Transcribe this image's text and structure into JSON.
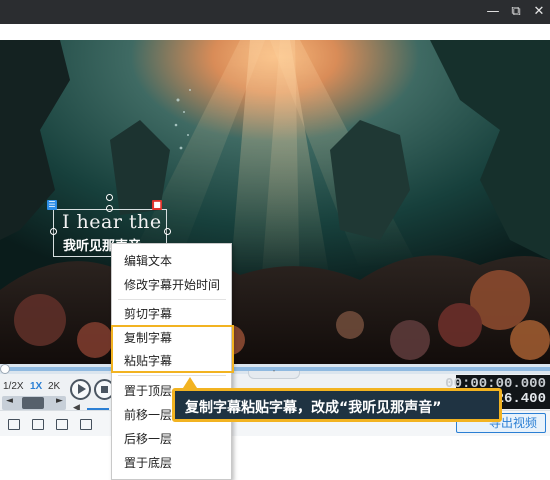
{
  "window": {
    "minimize_icon": "minimize-icon",
    "maximize_icon": "restore-icon",
    "close_icon": "close-icon",
    "minimize_glyph": "—",
    "maximize_glyph": "⧉",
    "close_glyph": "✕"
  },
  "video": {
    "subtitle_en": "I hear the",
    "subtitle_zh": "我听见那声音",
    "edit_glyph": "☰",
    "delete_glyph": "■"
  },
  "player": {
    "speeds": [
      "1/2X",
      "1X",
      "2K"
    ],
    "active_speed": "1X",
    "frame_back": "◄",
    "frame_forward": "►",
    "volume_glyph": "◀",
    "collapse_glyph": "˅",
    "progress": 0.0,
    "current_time": "00:00:00.000",
    "total_time": "26.400"
  },
  "toolbar": {
    "export_label": "导出视频"
  },
  "context_menu": {
    "groups": [
      [
        "编辑文本",
        "修改字幕开始时间"
      ],
      [
        "剪切字幕",
        "复制字幕",
        "粘贴字幕"
      ],
      [
        "置于顶层",
        "前移一层",
        "后移一层",
        "置于底层"
      ]
    ],
    "highlighted": [
      "复制字幕",
      "粘贴字幕"
    ]
  },
  "callout": {
    "text": "复制字幕粘贴字幕，改成“我听见那声音”"
  },
  "colors": {
    "accent_blue": "#2b7fd4",
    "highlight_orange": "#f2b321",
    "titlebar": "#2b2d30"
  }
}
